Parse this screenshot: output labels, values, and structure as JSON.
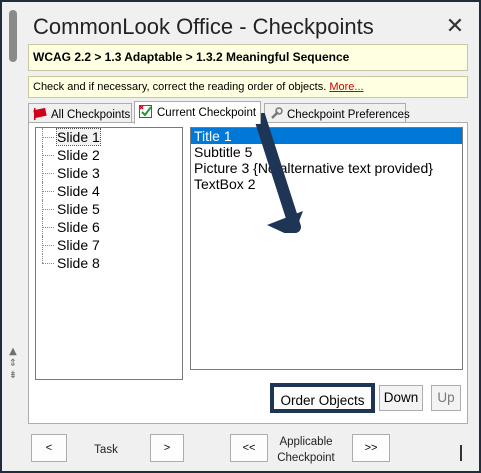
{
  "window": {
    "title": "CommonLook Office - Checkpoints",
    "close_glyph": "✕"
  },
  "checkpoint": {
    "path": "WCAG 2.2 > 1.3 Adaptable > 1.3.2 Meaningful Sequence",
    "description": "Check and if necessary, correct the reading order of objects. ",
    "more_link": "More..."
  },
  "tabs": [
    {
      "label": "All Checkpoints",
      "icon": "flag-icon"
    },
    {
      "label": "Current Checkpoint",
      "icon": "check-icon"
    },
    {
      "label": "Checkpoint Preferences",
      "icon": "wrench-icon"
    }
  ],
  "slides": [
    "Slide 1",
    "Slide 2",
    "Slide 3",
    "Slide 4",
    "Slide 5",
    "Slide 6",
    "Slide 7",
    "Slide 8"
  ],
  "objects": [
    "Title 1",
    "Subtitle 5",
    "Picture 3 {No alternative text provided}",
    "TextBox 2"
  ],
  "buttons": {
    "order": "Order Objects",
    "down": "Down",
    "up": "Up"
  },
  "navigation": {
    "task_prev": "<",
    "task_label": "Task",
    "task_next": ">",
    "checkpoint_prev": "<<",
    "checkpoint_label_line1": "Applicable",
    "checkpoint_label_line2": "Checkpoint",
    "checkpoint_next": ">>"
  },
  "colors": {
    "selection": "#0078d7",
    "highlight_border": "#1f3556",
    "info_background": "#ffffe1",
    "link": "#cc0000"
  }
}
